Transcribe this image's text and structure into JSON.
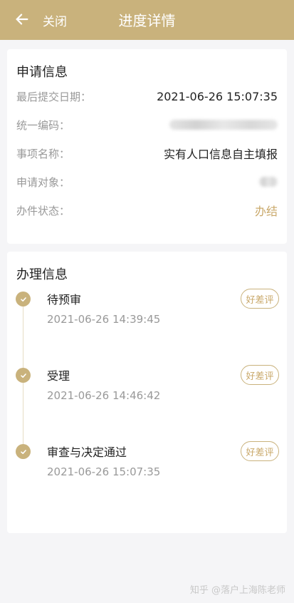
{
  "header": {
    "close_label": "关闭",
    "title": "进度详情"
  },
  "apply_info": {
    "title": "申请信息",
    "rows": [
      {
        "label": "最后提交日期：",
        "value": "2021-06-26 15:07:35"
      },
      {
        "label": "统一编码：",
        "value": ""
      },
      {
        "label": "事项名称：",
        "value": "实有人口信息自主填报"
      },
      {
        "label": "申请对象：",
        "value": ""
      },
      {
        "label": "办件状态：",
        "value": "办结"
      }
    ]
  },
  "process_info": {
    "title": "办理信息",
    "steps": [
      {
        "name": "待预审",
        "time": "2021-06-26 14:39:45",
        "rate_label": "好差评"
      },
      {
        "name": "受理",
        "time": "2021-06-26 14:46:42",
        "rate_label": "好差评"
      },
      {
        "name": "审查与决定通过",
        "time": "2021-06-26 15:07:35",
        "rate_label": "好差评"
      }
    ]
  },
  "watermark": "知乎 @落户上海陈老师",
  "colors": {
    "accent": "#c9b27c",
    "status": "#c9a86a",
    "background": "#f5f5f7"
  }
}
